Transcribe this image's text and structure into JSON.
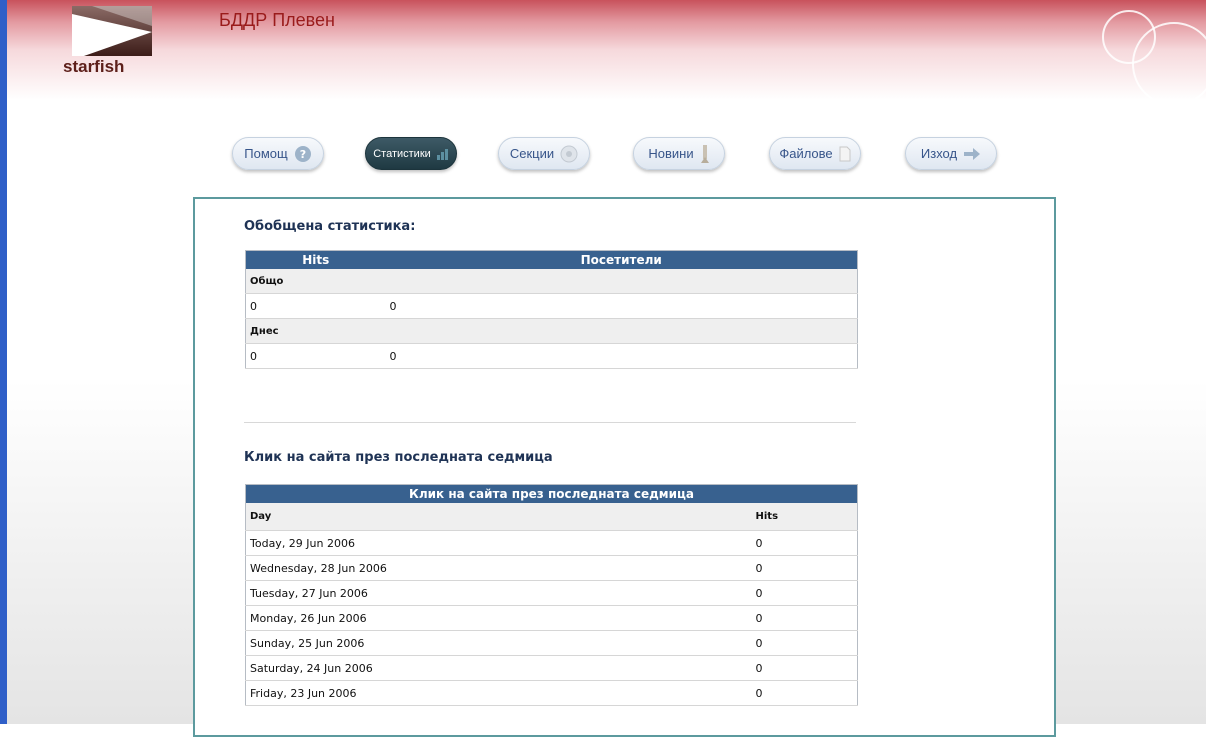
{
  "header": {
    "logo_text": "starfish",
    "site_title": "БДДР Плевен"
  },
  "nav": {
    "help": "Помощ",
    "stats": "Статистики",
    "sections": "Секции",
    "news": "Новини",
    "files": "Файлове",
    "logout": "Изход"
  },
  "summary": {
    "heading": "Обобщена статистика:",
    "col_hits": "Hits",
    "col_visitors": "Посетители",
    "total_label": "Общо",
    "total_hits": "0",
    "total_visitors": "0",
    "today_label": "Днес",
    "today_hits": "0",
    "today_visitors": "0"
  },
  "weekly": {
    "heading": "Клик на сайта през последната седмица",
    "table_title": "Клик на сайта през последната седмица",
    "col_day": "Day",
    "col_hits": "Hits",
    "rows": [
      {
        "day": "Today, 29 Jun 2006",
        "hits": "0"
      },
      {
        "day": "Wednesday, 28 Jun 2006",
        "hits": "0"
      },
      {
        "day": "Tuesday, 27 Jun 2006",
        "hits": "0"
      },
      {
        "day": "Monday, 26 Jun 2006",
        "hits": "0"
      },
      {
        "day": "Sunday, 25 Jun 2006",
        "hits": "0"
      },
      {
        "day": "Saturday, 24 Jun 2006",
        "hits": "0"
      },
      {
        "day": "Friday, 23 Jun 2006",
        "hits": "0"
      }
    ]
  },
  "icons": {
    "help": "help-icon",
    "stats": "bar-chart-icon",
    "sections": "sections-icon",
    "news": "news-icon",
    "files": "file-icon",
    "logout": "arrow-right-icon"
  },
  "colors": {
    "header_red": "#c8525c",
    "title_red": "#9a1b1b",
    "table_header": "#38618f",
    "panel_border": "#5c9a9e",
    "active_button": "#2a4650"
  }
}
